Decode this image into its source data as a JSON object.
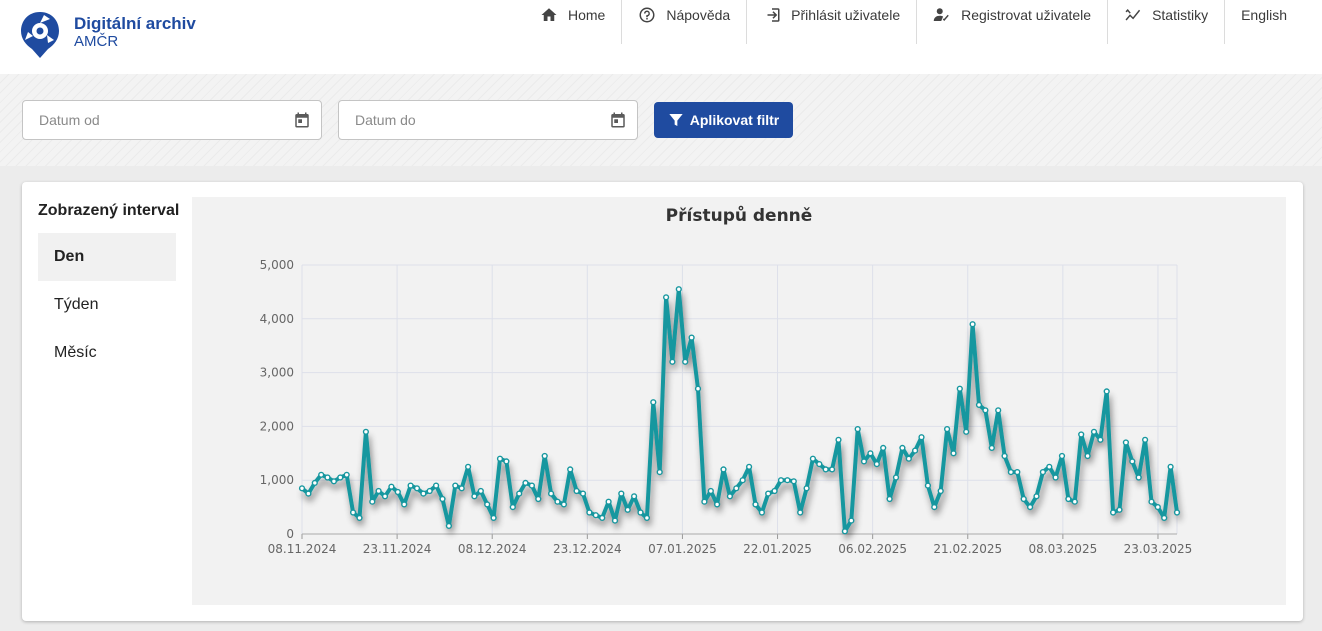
{
  "brand": {
    "title": "Digitální archiv",
    "subtitle": "AMČR"
  },
  "nav": [
    {
      "label": "Home",
      "icon": "home-icon"
    },
    {
      "label": "Nápověda",
      "icon": "help-icon"
    },
    {
      "label": "Přihlásit uživatele",
      "icon": "login-icon"
    },
    {
      "label": "Registrovat uživatele",
      "icon": "register-icon"
    },
    {
      "label": "Statistiky",
      "icon": "stats-icon"
    },
    {
      "label": "English",
      "icon": ""
    }
  ],
  "filter": {
    "date_from_placeholder": "Datum od",
    "date_to_placeholder": "Datum do",
    "apply_label": "Aplikovat filtr"
  },
  "interval": {
    "title": "Zobrazený interval",
    "options": [
      "Den",
      "Týden",
      "Měsíc"
    ],
    "selected": "Den"
  },
  "colors": {
    "brand": "#1f4ba0",
    "series": "#17979f"
  },
  "chart_data": {
    "type": "line",
    "title": "Přístupů denně",
    "xlabel": "",
    "ylabel": "",
    "ylim": [
      0,
      5000
    ],
    "yticks": [
      0,
      1000,
      2000,
      3000,
      4000,
      5000
    ],
    "ytick_labels": [
      "0",
      "1,000",
      "2,000",
      "3,000",
      "4,000",
      "5,000"
    ],
    "x_start": "2024-11-08",
    "x_end": "2025-03-26",
    "xtick_labels": [
      "08.11.2024",
      "23.11.2024",
      "08.12.2024",
      "23.12.2024",
      "07.01.2025",
      "22.01.2025",
      "06.02.2025",
      "21.02.2025",
      "08.03.2025",
      "23.03.2025"
    ],
    "grid": true,
    "series": [
      {
        "values": [
          850,
          750,
          950,
          1100,
          1050,
          980,
          1050,
          1100,
          400,
          300,
          1900,
          600,
          800,
          700,
          880,
          780,
          550,
          900,
          850,
          750,
          800,
          900,
          650,
          150,
          900,
          850,
          1250,
          700,
          800,
          550,
          300,
          1400,
          1350,
          500,
          750,
          950,
          900,
          650,
          1450,
          750,
          600,
          550,
          1200,
          800,
          750,
          400,
          350,
          300,
          600,
          250,
          750,
          450,
          700,
          400,
          300,
          2450,
          1150,
          4400,
          3200,
          4550,
          3200,
          3650,
          2700,
          600,
          800,
          550,
          1200,
          700,
          850,
          1000,
          1250,
          550,
          400,
          750,
          800,
          1000,
          1000,
          980,
          400,
          850,
          1400,
          1300,
          1200,
          1200,
          1750,
          50,
          250,
          1950,
          1350,
          1500,
          1300,
          1600,
          650,
          1050,
          1600,
          1400,
          1550,
          1800,
          900,
          500,
          800,
          1950,
          1500,
          2700,
          1900,
          3900,
          2400,
          2300,
          1600,
          2300,
          1450,
          1150,
          1150,
          650,
          500,
          700,
          1150,
          1250,
          1050,
          1450,
          650,
          600,
          1850,
          1450,
          1900,
          1750,
          2650,
          400,
          450,
          1700,
          1350,
          1050,
          1750,
          600,
          500,
          300,
          1250,
          400
        ]
      }
    ]
  }
}
